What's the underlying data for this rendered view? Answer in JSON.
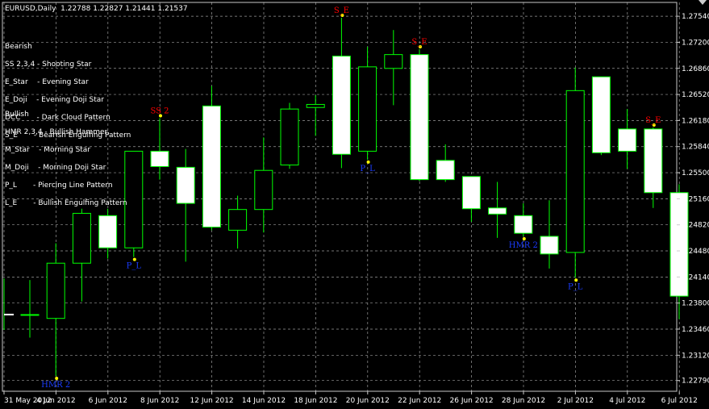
{
  "header": {
    "symbol": "EURUSD,Daily",
    "ohlc": "1.22788 1.22827 1.21441 1.21537"
  },
  "legend": {
    "bearish_title": "Bearish",
    "bearish_items": [
      "SS 2,3,4 - Shooting Star",
      "E_Star    - Evening Star",
      "E_Doji    - Evening Doji Star",
      "DCC       - Dark Cloud Pattern",
      "S_E       - Bearish Engulfing Pattern"
    ],
    "bullish_title": "Bullish",
    "bullish_items": [
      "HMR 2,3,4 - Bullish Hammer",
      "M_Star    - Morning Star",
      "M_Doji    - Morning Doji Star",
      "P_L       - Piercing Line Pattern",
      "L_E       - Bullish Engulfing Pattern"
    ]
  },
  "colors": {
    "background": "#000000",
    "grid": "#9a9a9a",
    "bull_candle_fill": "#000000",
    "bear_candle_fill": "#ffffff",
    "candle_outline": "#00ff00",
    "wick": "#00ff00",
    "bearish_label": "#ff0000",
    "bullish_label": "#1a3cff",
    "marker": "#ffff00",
    "axis_text": "#ffffff"
  },
  "chart_data": {
    "type": "candlestick",
    "title": "EURUSD,Daily",
    "y_axis_ticks": [
      "1.27540",
      "1.27200",
      "1.26860",
      "1.26520",
      "1.26180",
      "1.25840",
      "1.25500",
      "1.25160",
      "1.24820",
      "1.24480",
      "1.24140",
      "1.23800",
      "1.23460",
      "1.23120",
      "1.22790"
    ],
    "x_axis_ticks": [
      "31 May 2012",
      "4 Jun 2012",
      "6 Jun 2012",
      "8 Jun 2012",
      "12 Jun 2012",
      "14 Jun 2012",
      "18 Jun 2012",
      "20 Jun 2012",
      "22 Jun 2012",
      "26 Jun 2012",
      "28 Jun 2012",
      "2 Jul 2012",
      "4 Jul 2012",
      "6 Jul 2012"
    ],
    "ylim": [
      1.2265,
      1.2772
    ],
    "grid": true,
    "candles": [
      {
        "o": 1.2365,
        "h": 1.241,
        "l": 1.2335,
        "c": 1.2365
      },
      {
        "o": 1.236,
        "h": 1.2458,
        "l": 1.2285,
        "c": 1.2432
      },
      {
        "o": 1.2432,
        "h": 1.2503,
        "l": 1.2382,
        "c": 1.2497
      },
      {
        "o": 1.2494,
        "h": 1.2503,
        "l": 1.2438,
        "c": 1.2452
      },
      {
        "o": 1.2452,
        "h": 1.253,
        "l": 1.244,
        "c": 1.2578
      },
      {
        "o": 1.2578,
        "h": 1.2621,
        "l": 1.2541,
        "c": 1.2558
      },
      {
        "o": 1.2557,
        "h": 1.2581,
        "l": 1.2434,
        "c": 1.251
      },
      {
        "o": 1.2637,
        "h": 1.2663,
        "l": 1.2475,
        "c": 1.2479
      },
      {
        "o": 1.2475,
        "h": 1.252,
        "l": 1.2451,
        "c": 1.2502
      },
      {
        "o": 1.2502,
        "h": 1.2596,
        "l": 1.2472,
        "c": 1.2553
      },
      {
        "o": 1.256,
        "h": 1.2641,
        "l": 1.2555,
        "c": 1.2633
      },
      {
        "o": 1.2635,
        "h": 1.2651,
        "l": 1.2598,
        "c": 1.2639
      },
      {
        "o": 1.2702,
        "h": 1.2752,
        "l": 1.2556,
        "c": 1.2574
      },
      {
        "o": 1.2578,
        "h": 1.2714,
        "l": 1.2567,
        "c": 1.2688
      },
      {
        "o": 1.2686,
        "h": 1.2736,
        "l": 1.2638,
        "c": 1.2704
      },
      {
        "o": 1.2704,
        "h": 1.2711,
        "l": 1.2539,
        "c": 1.2541
      },
      {
        "o": 1.2566,
        "h": 1.2587,
        "l": 1.2538,
        "c": 1.2541
      },
      {
        "o": 1.2545,
        "h": 1.2545,
        "l": 1.2486,
        "c": 1.2503
      },
      {
        "o": 1.2504,
        "h": 1.2538,
        "l": 1.2465,
        "c": 1.2496
      },
      {
        "o": 1.2494,
        "h": 1.251,
        "l": 1.2467,
        "c": 1.2471
      },
      {
        "o": 1.2467,
        "h": 1.2514,
        "l": 1.2425,
        "c": 1.2444
      },
      {
        "o": 1.2446,
        "h": 1.2687,
        "l": 1.2413,
        "c": 1.2657
      },
      {
        "o": 1.2675,
        "h": 1.2675,
        "l": 1.2573,
        "c": 1.2576
      },
      {
        "o": 1.2607,
        "h": 1.2633,
        "l": 1.2555,
        "c": 1.2578
      },
      {
        "o": 1.2607,
        "h": 1.2609,
        "l": 1.2504,
        "c": 1.2524
      },
      {
        "o": 1.2524,
        "h": 1.2535,
        "l": 1.2359,
        "c": 1.2389
      }
    ],
    "candle_x_positions_note": "candles indexed by trading day",
    "annotations": [
      {
        "candle": 5,
        "text": "SS 2",
        "kind": "bearish",
        "anchor": "high"
      },
      {
        "candle": 4,
        "text": "P_L",
        "kind": "bullish",
        "anchor": "low"
      },
      {
        "candle": 12,
        "text": "S_E",
        "kind": "bearish",
        "anchor": "high"
      },
      {
        "candle": 13,
        "text": "P_L",
        "kind": "bullish",
        "anchor": "low"
      },
      {
        "candle": 15,
        "text": "S_E",
        "kind": "bearish",
        "anchor": "high"
      },
      {
        "candle": 19,
        "text": "HMR 2",
        "kind": "bullish",
        "anchor": "low"
      },
      {
        "candle": 21,
        "text": "P_L",
        "kind": "bullish",
        "anchor": "low"
      },
      {
        "candle": 24,
        "text": "S_E",
        "kind": "bearish",
        "anchor": "high"
      },
      {
        "candle": 1,
        "text": "HMR 2",
        "kind": "bullish",
        "anchor": "low"
      }
    ]
  }
}
